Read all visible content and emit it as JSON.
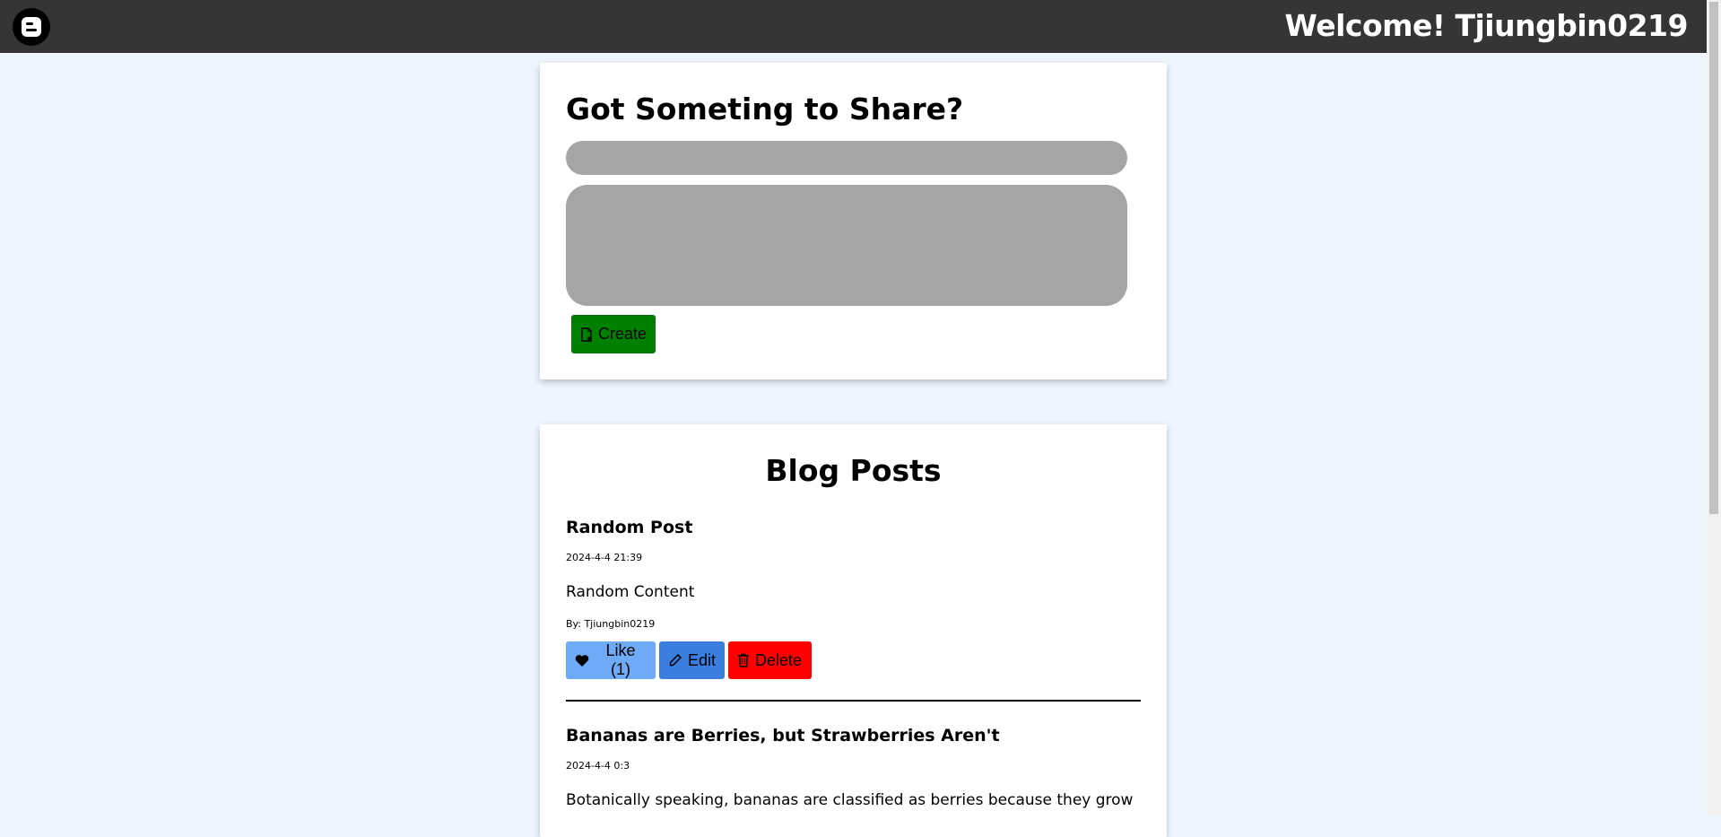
{
  "header": {
    "welcome_text": "Welcome! Tjiungbin0219",
    "logo_icon": "blogger-logo-icon"
  },
  "create": {
    "heading": "Got Someting to Share?",
    "title_placeholder": "",
    "content_placeholder": "",
    "create_label": "Create",
    "create_icon": "file-plus-icon",
    "button_color": "#008000"
  },
  "posts": {
    "heading": "Blog Posts",
    "items": [
      {
        "title": "Random Post",
        "date": "2024-4-4 21:39",
        "content": "Random Content",
        "author": "By: Tjiungbin0219",
        "like_label": "Like (1)",
        "edit_label": "Edit",
        "delete_label": "Delete"
      },
      {
        "title": "Bananas are Berries, but Strawberries Aren't",
        "date": "2024-4-4 0:3",
        "content": "Botanically speaking, bananas are classified as berries because they grow"
      }
    ]
  },
  "colors": {
    "topbar": "#343537",
    "background": "#eef5fe",
    "like": "#6eaaf5",
    "edit": "#3a7ee0",
    "delete": "#ff0000",
    "input": "#a5a5a5"
  }
}
